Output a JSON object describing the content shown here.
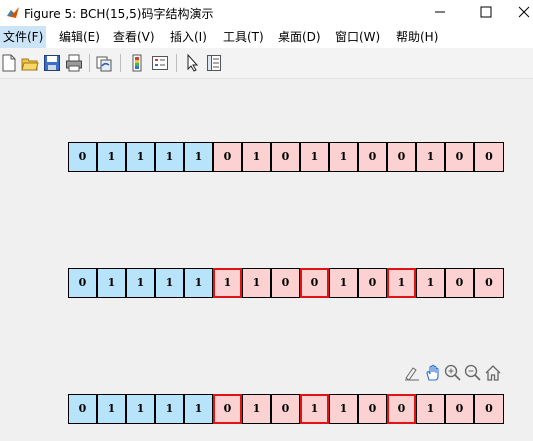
{
  "window": {
    "title": "Figure 5: BCH(15,5)码字结构演示"
  },
  "menu": [
    {
      "label": "文件(F)",
      "active": true
    },
    {
      "label": "编辑(E)"
    },
    {
      "label": "查看(V)"
    },
    {
      "label": "插入(I)"
    },
    {
      "label": "工具(T)"
    },
    {
      "label": "桌面(D)"
    },
    {
      "label": "窗口(W)"
    },
    {
      "label": "帮助(H)"
    }
  ],
  "toolbar": [
    "new-figure-icon",
    "open-file-icon",
    "save-icon",
    "print-icon",
    "link-plot-icon",
    "insert-colorbar-icon",
    "insert-legend-icon",
    "edit-plot-icon",
    "property-inspector-icon"
  ],
  "axes_toolbar": [
    "brush-icon",
    "pan-icon",
    "zoom-in-icon",
    "zoom-out-icon",
    "home-icon"
  ],
  "colors": {
    "info": "#b8e4fb",
    "check": "#fcd1d1",
    "highlight": "#e01414"
  },
  "rows": [
    {
      "bits": [
        "0",
        "1",
        "1",
        "1",
        "1",
        "0",
        "1",
        "0",
        "1",
        "1",
        "0",
        "0",
        "1",
        "0",
        "0"
      ],
      "highlight": []
    },
    {
      "bits": [
        "0",
        "1",
        "1",
        "1",
        "1",
        "1",
        "1",
        "0",
        "0",
        "1",
        "0",
        "1",
        "1",
        "0",
        "0"
      ],
      "highlight": [
        5,
        8,
        11
      ]
    },
    {
      "bits": [
        "0",
        "1",
        "1",
        "1",
        "1",
        "0",
        "1",
        "0",
        "1",
        "1",
        "0",
        "0",
        "1",
        "0",
        "0"
      ],
      "highlight": [
        5,
        8,
        11
      ]
    }
  ],
  "info_bits": 5
}
